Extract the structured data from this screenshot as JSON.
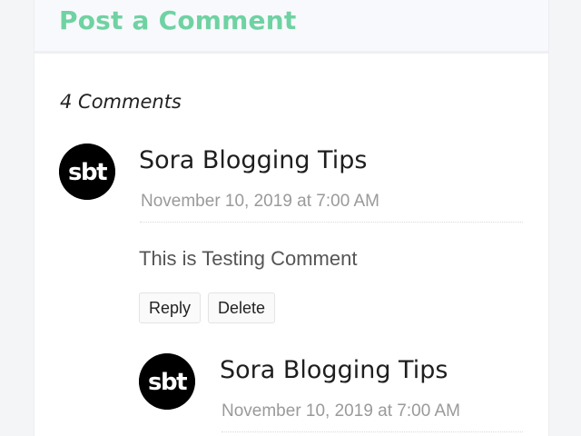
{
  "header": {
    "title": "Post a Comment"
  },
  "comments": {
    "count_label": "4 Comments",
    "items": [
      {
        "avatar_text": "sbt",
        "author": "Sora Blogging Tips",
        "date": "November 10, 2019 at 7:00 AM",
        "text": "This is Testing Comment",
        "reply_label": "Reply",
        "delete_label": "Delete"
      },
      {
        "avatar_text": "sbt",
        "author": "Sora Blogging Tips",
        "date": "November 10, 2019 at 7:00 AM"
      }
    ]
  },
  "colors": {
    "accent": "#6fd2a2",
    "avatar_bg": "#000000"
  }
}
